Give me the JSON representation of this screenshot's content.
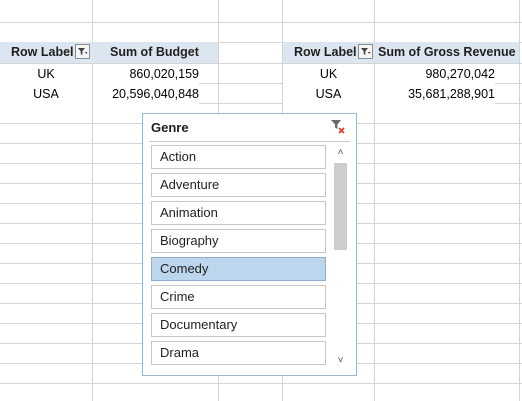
{
  "pivot_left": {
    "header": {
      "row_label": "Row Label",
      "value_label": "Sum of Budget"
    },
    "rows": [
      {
        "label": "UK",
        "value": "860,020,159"
      },
      {
        "label": "USA",
        "value": "20,596,040,848"
      }
    ]
  },
  "pivot_right": {
    "header": {
      "row_label": "Row Label",
      "value_label": "Sum of Gross Revenue"
    },
    "rows": [
      {
        "label": "UK",
        "value": "980,270,042"
      },
      {
        "label": "USA",
        "value": "35,681,288,901"
      }
    ]
  },
  "slicer": {
    "title": "Genre",
    "clear_icon": "clear-filter-icon",
    "items": [
      {
        "label": "Action",
        "selected": false
      },
      {
        "label": "Adventure",
        "selected": false
      },
      {
        "label": "Animation",
        "selected": false
      },
      {
        "label": "Biography",
        "selected": false
      },
      {
        "label": "Comedy",
        "selected": true
      },
      {
        "label": "Crime",
        "selected": false
      },
      {
        "label": "Documentary",
        "selected": false
      },
      {
        "label": "Drama",
        "selected": false
      }
    ]
  },
  "colors": {
    "header_fill": "#dce6f1",
    "selected_item": "#bcd6ee",
    "gridline": "#d4d4d4"
  }
}
